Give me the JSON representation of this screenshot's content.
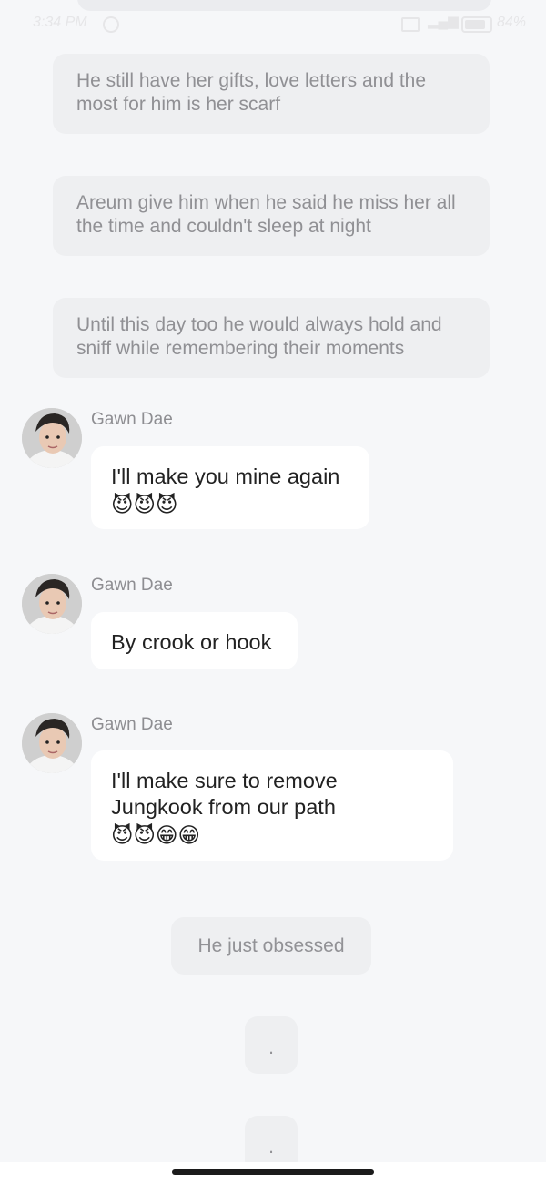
{
  "status_bar": {
    "time": "3:34 PM",
    "battery": "84%",
    "signal": "4G",
    "alarm_icon": "alarm-clock-icon",
    "battery_icon": "battery-icon"
  },
  "narration": [
    "He still have her gifts, love letters and the most for him is her scarf",
    "Areum give him when he said he miss her all the time and couldn't sleep at night",
    "Until this day too he would always hold and sniff while remembering their moments"
  ],
  "messages": [
    {
      "sender": "Gawn Dae",
      "text": "I'll make you mine again",
      "emoji": "😈😈😈"
    },
    {
      "sender": "Gawn Dae",
      "text": "By crook or hook",
      "emoji": ""
    },
    {
      "sender": "Gawn Dae",
      "text": "I'll make sure to remove Jungkook from our path",
      "emoji": "😈😈😁😁"
    }
  ],
  "center_notes": [
    "He just obsessed",
    ".",
    "."
  ],
  "colors": {
    "background": "#f6f7f9",
    "narration_bg": "#eeeff1",
    "bubble_bg": "#ffffff"
  }
}
